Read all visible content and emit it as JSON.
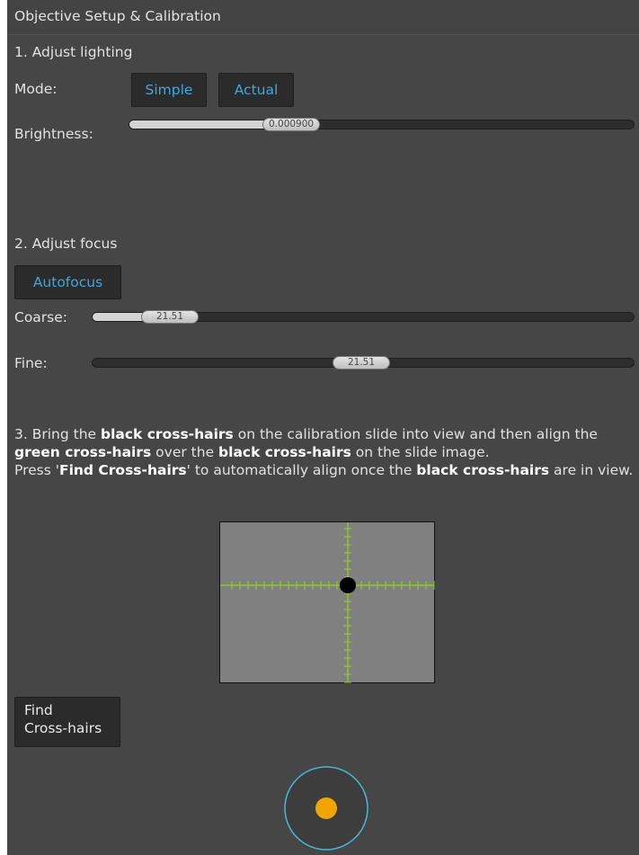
{
  "header": {
    "title": "Objective Setup & Calibration"
  },
  "lighting": {
    "heading": "1. Adjust lighting",
    "mode_label": "Mode:",
    "mode_simple": "Simple",
    "mode_actual": "Actual",
    "brightness_label": "Brightness:",
    "brightness_value": "0.000900"
  },
  "focus": {
    "heading": "2. Adjust focus",
    "autofocus_label": "Autofocus",
    "coarse_label": "Coarse:",
    "coarse_value": "21.51",
    "fine_label": "Fine:",
    "fine_value": "21.51"
  },
  "calibration": {
    "p1": "3. Bring the ",
    "b1": "black cross-hairs",
    "p2": " on the calibration slide into view and then align the ",
    "b2": "green cross-hairs",
    "p3": " over the ",
    "b3": "black cross-hairs",
    "p4": " on the slide image.",
    "p5": "Press '",
    "b4": "Find Cross-hairs",
    "p6": "' to automatically align once the ",
    "b5": "black cross-hairs",
    "p7": " are in view.",
    "find_line1": "Find",
    "find_line2": "Cross-hairs"
  },
  "colors": {
    "panel_bg": "#464646",
    "accent": "#3fa7df",
    "crosshair": "#8fd41a",
    "joystick_ring": "#46b9d8",
    "joystick_knob": "#f2a500"
  }
}
